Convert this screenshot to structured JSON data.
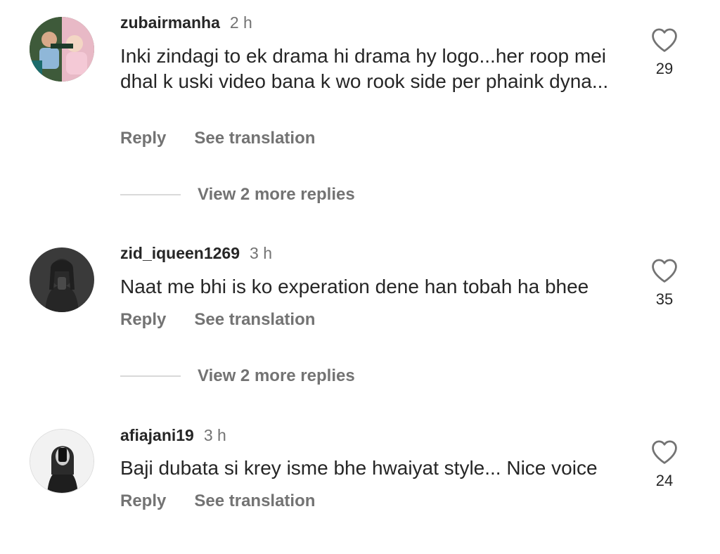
{
  "comments": [
    {
      "username": "zubairmanha",
      "time": "2 h",
      "text": "Inki zindagi to ek drama hi drama hy logo...her roop mei dhal k uski video bana k wo rook side per phaink dyna...",
      "reply_label": "Reply",
      "translate_label": "See translation",
      "likes": "29",
      "view_replies": "View 2 more replies",
      "avatar_icon": "avatar-photo-icon"
    },
    {
      "username": "zid_iqueen1269",
      "time": "3 h",
      "text": "Naat me bhi is ko experation dene han tobah ha bhee",
      "reply_label": "Reply",
      "translate_label": "See translation",
      "likes": "35",
      "view_replies": "View 2 more replies",
      "avatar_icon": "avatar-photo-icon"
    },
    {
      "username": "afiajani19",
      "time": "3 h",
      "text": "Baji dubata si krey isme bhe hwaiyat style... Nice voice",
      "reply_label": "Reply",
      "translate_label": "See translation",
      "likes": "24",
      "avatar_icon": "avatar-photo-icon"
    }
  ],
  "icons": {
    "like": "heart-outline-icon"
  },
  "colors": {
    "text": "#262626",
    "secondary": "#737373",
    "divider": "#d9d9d9"
  }
}
